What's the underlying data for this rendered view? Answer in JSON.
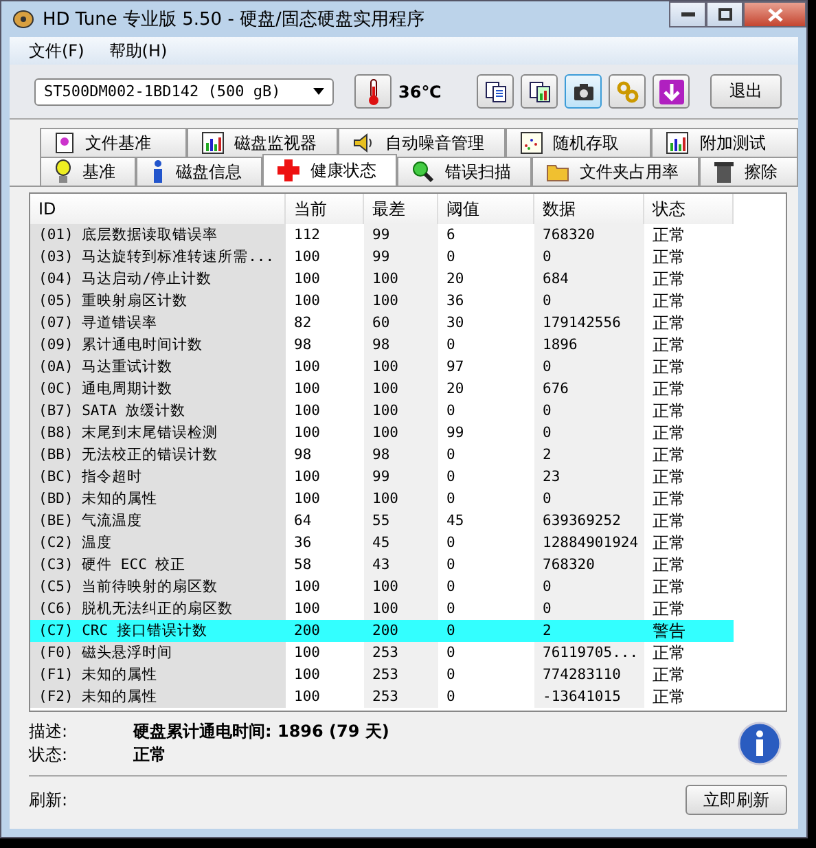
{
  "window": {
    "title": "HD Tune 专业版 5.50 - 硬盘/固态硬盘实用程序"
  },
  "menu": [
    "文件(F)",
    "帮助(H)"
  ],
  "toolbar": {
    "drive": "ST500DM002-1BD142 (500 gB)",
    "temperature": "36℃",
    "exit": "退出"
  },
  "tabs_top": [
    {
      "label": "文件基准",
      "selected": false
    },
    {
      "label": "磁盘监视器",
      "selected": false
    },
    {
      "label": "自动噪音管理",
      "selected": false
    },
    {
      "label": "随机存取",
      "selected": false
    },
    {
      "label": "附加测试",
      "selected": false
    }
  ],
  "tabs_bottom": [
    {
      "label": "基准",
      "selected": false
    },
    {
      "label": "磁盘信息",
      "selected": false
    },
    {
      "label": "健康状态",
      "selected": true
    },
    {
      "label": "错误扫描",
      "selected": false
    },
    {
      "label": "文件夹占用率",
      "selected": false
    },
    {
      "label": "擦除",
      "selected": false
    }
  ],
  "table": {
    "columns": [
      "ID",
      "当前",
      "最差",
      "阈值",
      "数据",
      "状态"
    ],
    "rows": [
      {
        "cells": [
          "(01) 底层数据读取错误率",
          "112",
          "99",
          "6",
          "768320",
          "正常"
        ],
        "selected": false
      },
      {
        "cells": [
          "(03) 马达旋转到标准转速所需...",
          "100",
          "99",
          "0",
          "0",
          "正常"
        ],
        "selected": false
      },
      {
        "cells": [
          "(04) 马达启动/停止计数",
          "100",
          "100",
          "20",
          "684",
          "正常"
        ],
        "selected": false
      },
      {
        "cells": [
          "(05) 重映射扇区计数",
          "100",
          "100",
          "36",
          "0",
          "正常"
        ],
        "selected": false
      },
      {
        "cells": [
          "(07) 寻道错误率",
          "82",
          "60",
          "30",
          "179142556",
          "正常"
        ],
        "selected": false
      },
      {
        "cells": [
          "(09) 累计通电时间计数",
          "98",
          "98",
          "0",
          "1896",
          "正常"
        ],
        "selected": false
      },
      {
        "cells": [
          "(0A) 马达重试计数",
          "100",
          "100",
          "97",
          "0",
          "正常"
        ],
        "selected": false
      },
      {
        "cells": [
          "(0C) 通电周期计数",
          "100",
          "100",
          "20",
          "676",
          "正常"
        ],
        "selected": false
      },
      {
        "cells": [
          "(B7) SATA 放缓计数",
          "100",
          "100",
          "0",
          "0",
          "正常"
        ],
        "selected": false
      },
      {
        "cells": [
          "(B8) 末尾到末尾错误检测",
          "100",
          "100",
          "99",
          "0",
          "正常"
        ],
        "selected": false
      },
      {
        "cells": [
          "(BB) 无法校正的错误计数",
          "98",
          "98",
          "0",
          "2",
          "正常"
        ],
        "selected": false
      },
      {
        "cells": [
          "(BC) 指令超时",
          "100",
          "99",
          "0",
          "23",
          "正常"
        ],
        "selected": false
      },
      {
        "cells": [
          "(BD) 未知的属性",
          "100",
          "100",
          "0",
          "0",
          "正常"
        ],
        "selected": false
      },
      {
        "cells": [
          "(BE) 气流温度",
          "64",
          "55",
          "45",
          "639369252",
          "正常"
        ],
        "selected": false
      },
      {
        "cells": [
          "(C2) 温度",
          "36",
          "45",
          "0",
          "12884901924",
          "正常"
        ],
        "selected": false
      },
      {
        "cells": [
          "(C3) 硬件 ECC 校正",
          "58",
          "43",
          "0",
          "768320",
          "正常"
        ],
        "selected": false
      },
      {
        "cells": [
          "(C5) 当前待映射的扇区数",
          "100",
          "100",
          "0",
          "0",
          "正常"
        ],
        "selected": false
      },
      {
        "cells": [
          "(C6) 脱机无法纠正的扇区数",
          "100",
          "100",
          "0",
          "0",
          "正常"
        ],
        "selected": false
      },
      {
        "cells": [
          "(C7) CRC 接口错误计数",
          "200",
          "200",
          "0",
          "2",
          "警告"
        ],
        "selected": true
      },
      {
        "cells": [
          "(F0) 磁头悬浮时间",
          "100",
          "253",
          "0",
          "76119705...",
          "正常"
        ],
        "selected": false
      },
      {
        "cells": [
          "(F1) 未知的属性",
          "100",
          "253",
          "0",
          "774283110",
          "正常"
        ],
        "selected": false
      },
      {
        "cells": [
          "(F2) 未知的属性",
          "100",
          "253",
          "0",
          "-13641015",
          "正常"
        ],
        "selected": false
      }
    ]
  },
  "details": {
    "description_label": "描述:",
    "description": "硬盘累计通电时间: 1896 (79 天)",
    "status_label": "状态:",
    "status": "正常"
  },
  "bottom": {
    "refresh_label": "刷新:",
    "refresh_button": "立即刷新"
  }
}
